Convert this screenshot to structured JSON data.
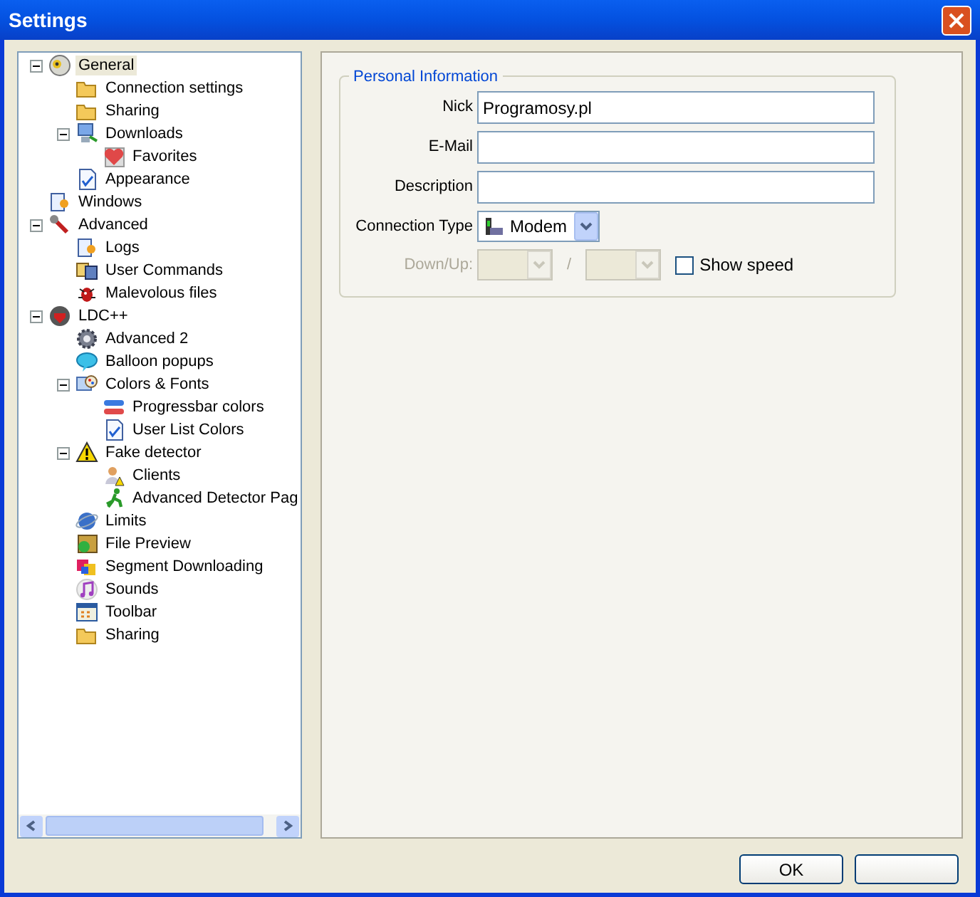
{
  "window": {
    "title": "Settings"
  },
  "tree": [
    {
      "label": "General",
      "selected": true,
      "expanded": true,
      "children": [
        {
          "label": "Connection settings",
          "selected": false
        },
        {
          "label": "Sharing",
          "selected": false
        },
        {
          "label": "Downloads",
          "selected": false,
          "expanded": true,
          "children": [
            {
              "label": "Favorites",
              "selected": false
            }
          ]
        },
        {
          "label": "Appearance",
          "selected": false
        }
      ]
    },
    {
      "label": "Windows",
      "selected": false
    },
    {
      "label": "Advanced",
      "selected": false,
      "expanded": true,
      "children": [
        {
          "label": "Logs",
          "selected": false
        },
        {
          "label": "User Commands",
          "selected": false
        },
        {
          "label": "Malevolous files",
          "selected": false
        }
      ]
    },
    {
      "label": "LDC++",
      "selected": false,
      "expanded": true,
      "children": [
        {
          "label": "Advanced 2",
          "selected": false
        },
        {
          "label": "Balloon popups",
          "selected": false
        },
        {
          "label": "Colors & Fonts",
          "selected": false,
          "expanded": true,
          "children": [
            {
              "label": "Progressbar colors",
              "selected": false
            },
            {
              "label": "User List Colors",
              "selected": false
            }
          ]
        },
        {
          "label": "Fake detector",
          "selected": false,
          "expanded": true,
          "children": [
            {
              "label": "Clients",
              "selected": false
            },
            {
              "label": "Advanced Detector Pag",
              "selected": false
            }
          ]
        },
        {
          "label": "Limits",
          "selected": false
        },
        {
          "label": "File Preview",
          "selected": false
        },
        {
          "label": "Segment Downloading",
          "selected": false
        },
        {
          "label": "Sounds",
          "selected": false
        },
        {
          "label": "Toolbar",
          "selected": false
        },
        {
          "label": "Sharing",
          "selected": false
        }
      ]
    }
  ],
  "personal_information": {
    "title": "Personal Information",
    "fields": [
      {
        "label": "Nick",
        "value": "Programosy.pl"
      },
      {
        "label": "E-Mail"
      },
      {
        "label": "Description"
      }
    ],
    "connection_type": {
      "label": "Connection Type",
      "value": "Modem"
    },
    "down_up": {
      "label": "Down/Up:",
      "disabled": true,
      "separator": "/"
    },
    "show_speed": {
      "label": "Show speed",
      "checked": false
    }
  },
  "buttons": [
    {
      "kind": "text",
      "label": "OK"
    },
    {
      "kind": "blank"
    }
  ]
}
